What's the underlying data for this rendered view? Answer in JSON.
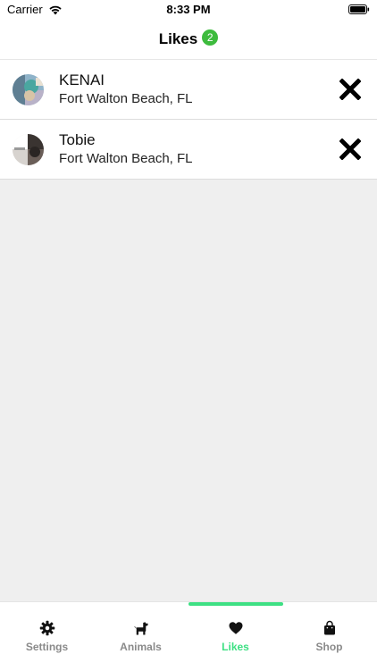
{
  "status_bar": {
    "carrier": "Carrier",
    "time": "8:33 PM",
    "icons": [
      "wifi-icon",
      "battery-icon"
    ]
  },
  "header": {
    "title": "Likes",
    "count": "2",
    "badge_color": "#3dbb3d"
  },
  "likes": [
    {
      "name": "KENAI",
      "location": "Fort Walton Beach, FL",
      "remove_icon": "close-icon"
    },
    {
      "name": "Tobie",
      "location": "Fort Walton Beach, FL",
      "remove_icon": "close-icon"
    }
  ],
  "tab_bar": {
    "active_color": "#3de083",
    "inactive_color": "#8a8a8a",
    "tabs": [
      {
        "label": "Settings",
        "icon": "gear-icon",
        "active": false
      },
      {
        "label": "Animals",
        "icon": "dog-icon",
        "active": false
      },
      {
        "label": "Likes",
        "icon": "heart-icon",
        "active": true
      },
      {
        "label": "Shop",
        "icon": "shopping-bag-icon",
        "active": false
      }
    ]
  }
}
